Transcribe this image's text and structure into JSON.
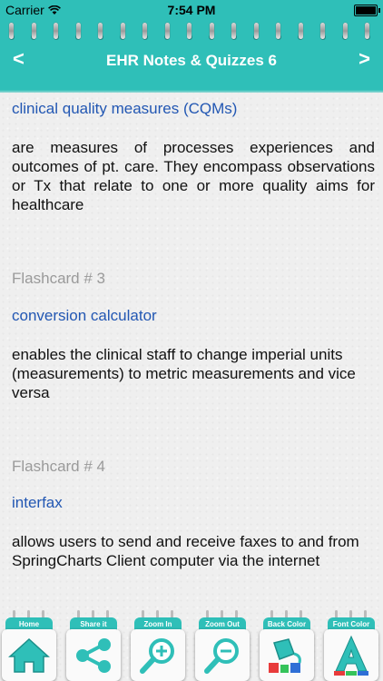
{
  "status": {
    "carrier": "Carrier",
    "time": "7:54 PM"
  },
  "nav": {
    "title": "EHR Notes & Quizzes 6",
    "back": "<",
    "forward": ">"
  },
  "cards": [
    {
      "term": "clinical quality measures (CQMs)",
      "definition": "are measures of processes experiences and outcomes of pt. care. They encompass observations or Tx that relate to one or more quality aims for healthcare"
    },
    {
      "label": "Flashcard # 3",
      "term": "conversion calculator",
      "definition": "enables the clinical staff to change imperial units (measurements) to metric measurements and vice versa"
    },
    {
      "label": "Flashcard # 4",
      "term": "interfax",
      "definition": "allows users to send and receive faxes to and from SpringCharts Client computer via the internet"
    }
  ],
  "toolbar": {
    "home": "Home",
    "share": "Share it",
    "zoom_in": "Zoom In",
    "zoom_out": "Zoom Out",
    "back_color": "Back Color",
    "font_color": "Font Color"
  },
  "colors": {
    "accent": "#2fbfb8",
    "term": "#2257b3"
  }
}
